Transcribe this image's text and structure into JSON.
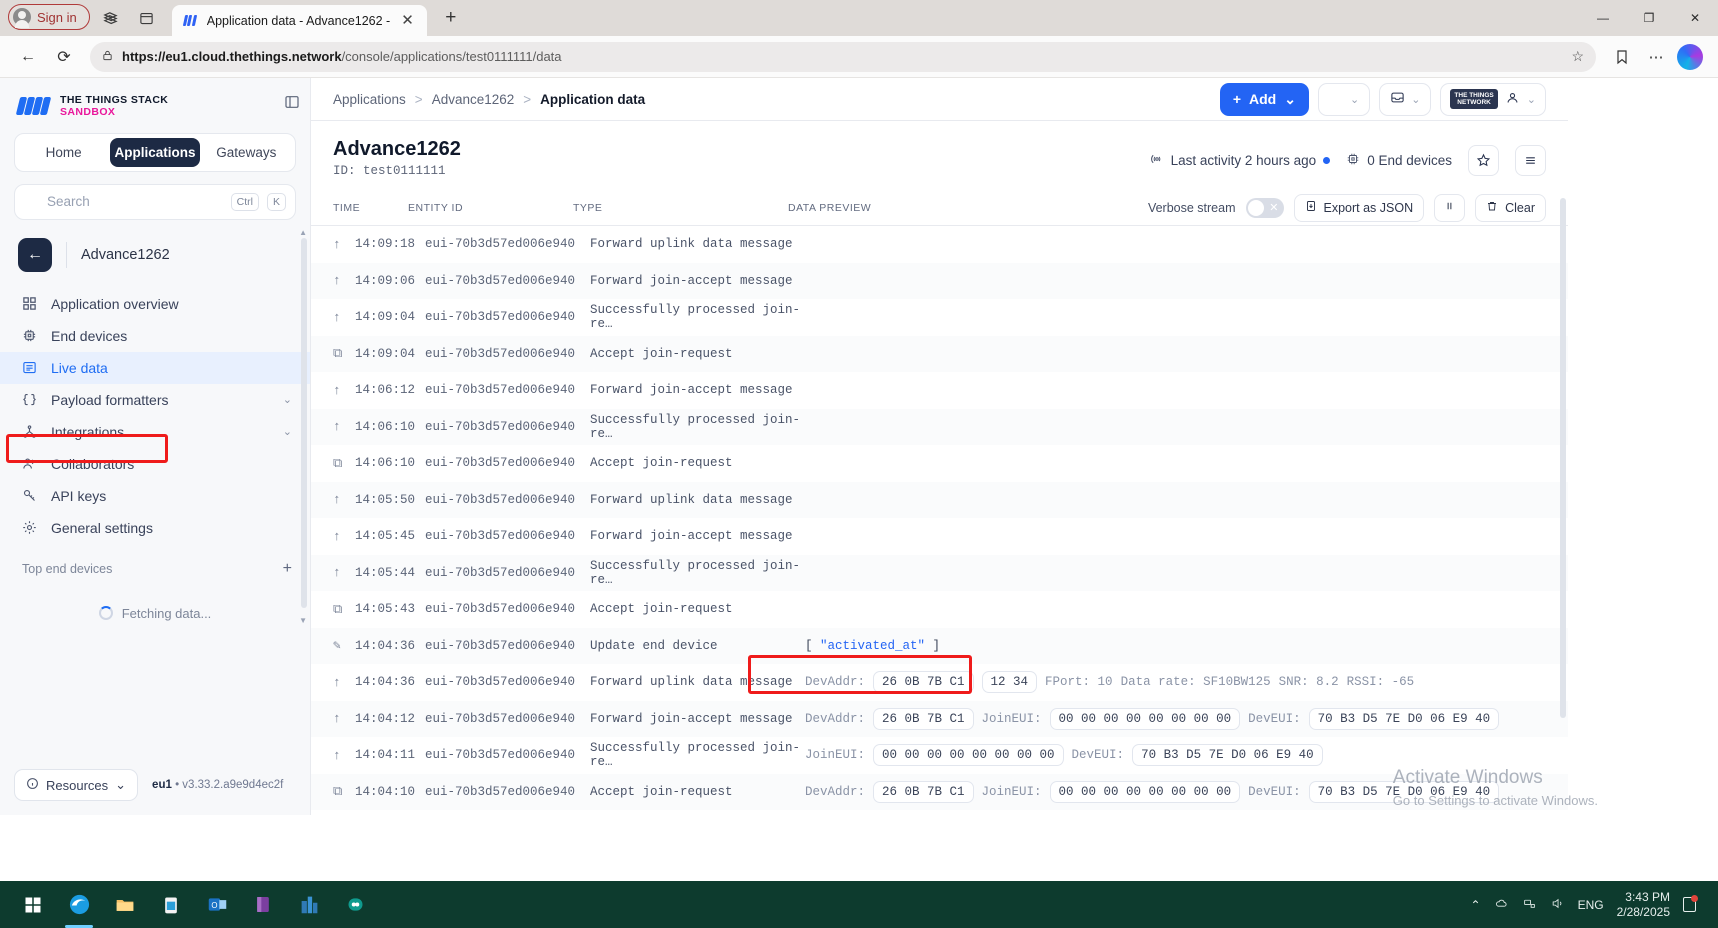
{
  "browser": {
    "signin_label": "Sign in",
    "tab_title": "Application data - Advance1262 -",
    "url_host": "https://eu1.cloud.thethings.network",
    "url_path": "/console/applications/test0111111/data",
    "new_tab_glyph": "+",
    "close_glyph": "✕",
    "minimize_glyph": "—",
    "maximize_glyph": "❐",
    "back_glyph": "←",
    "reload_glyph": "⟳",
    "lock_glyph": "🔒",
    "star_glyph": "☆",
    "collections_glyph": "▣",
    "split_glyph": "▥",
    "favorites_glyph": "☆",
    "more_glyph": "⋯"
  },
  "sidebar": {
    "brand_line1": "THE THINGS STACK",
    "brand_line2": "SANDBOX",
    "collapse_glyph": "◧",
    "tabs": [
      {
        "label": "Home",
        "active": false
      },
      {
        "label": "Applications",
        "active": true
      },
      {
        "label": "Gateways",
        "active": false
      }
    ],
    "search": {
      "placeholder": "Search",
      "kbd1": "Ctrl",
      "kbd2": "K",
      "icon": "search-icon"
    },
    "app_back_glyph": "←",
    "app_name": "Advance1262",
    "items": [
      {
        "label": "Application overview",
        "icon": "grid-icon",
        "active": false,
        "chevron": ""
      },
      {
        "label": "End devices",
        "icon": "chip-icon",
        "active": false,
        "chevron": ""
      },
      {
        "label": "Live data",
        "icon": "list-icon",
        "active": true,
        "chevron": ""
      },
      {
        "label": "Payload formatters",
        "icon": "braces-icon",
        "active": false,
        "chevron": "⌄"
      },
      {
        "label": "Integrations",
        "icon": "network-icon",
        "active": false,
        "chevron": "⌄"
      },
      {
        "label": "Collaborators",
        "icon": "users-icon",
        "active": false,
        "chevron": ""
      },
      {
        "label": "API keys",
        "icon": "key-icon",
        "active": false,
        "chevron": ""
      },
      {
        "label": "General settings",
        "icon": "gear-icon",
        "active": false,
        "chevron": ""
      }
    ],
    "top_end_devices_label": "Top end devices",
    "add_glyph": "+",
    "fetching_label": "Fetching data...",
    "resources_label": "Resources",
    "resources_chevron": "⌄",
    "cluster": "eu1",
    "version": "• v3.33.2.a9e9d4ec2f"
  },
  "breadcrumb": {
    "items": [
      "Applications",
      "Advance1262",
      "Application data"
    ],
    "separator": ">",
    "add_label": "Add",
    "add_plus": "+",
    "chevron": "⌄",
    "star_glyph": "☆",
    "inbox_glyph": "⌷",
    "ttn_chip_l1": "THE THINGS",
    "ttn_chip_l2": "NETWORK",
    "user_glyph": "◉"
  },
  "header": {
    "title": "Advance1262",
    "id_label": "ID: test0111111",
    "last_activity": "Last activity 2 hours ago",
    "last_activity_icon": "signal-icon",
    "end_devices": "0 End devices",
    "end_devices_icon": "chip-icon",
    "star_glyph": "☆",
    "menu_glyph": "☰"
  },
  "table": {
    "columns": [
      "TIME",
      "ENTITY ID",
      "TYPE",
      "DATA PREVIEW"
    ],
    "verbose_label": "Verbose stream",
    "verbose_on": false,
    "verbose_off_glyph": "✕",
    "export_label": "Export as JSON",
    "export_icon": "download-icon",
    "pause_icon": "pause-icon",
    "clear_label": "Clear",
    "clear_icon": "trash-icon",
    "rows": [
      {
        "icon": "uplink-arrow-icon",
        "glyph": "↑",
        "time": "14:09:18",
        "entity": "eui-70b3d57ed006e940",
        "type": "Forward uplink data message",
        "preview": []
      },
      {
        "icon": "uplink-arrow-icon",
        "glyph": "↑",
        "time": "14:09:06",
        "entity": "eui-70b3d57ed006e940",
        "type": "Forward join-accept message",
        "preview": []
      },
      {
        "icon": "uplink-arrow-icon",
        "glyph": "↑",
        "time": "14:09:04",
        "entity": "eui-70b3d57ed006e940",
        "type": "Successfully processed join-re…",
        "preview": []
      },
      {
        "icon": "join-link-icon",
        "glyph": "⧉",
        "time": "14:09:04",
        "entity": "eui-70b3d57ed006e940",
        "type": "Accept join-request",
        "preview": []
      },
      {
        "icon": "uplink-arrow-icon",
        "glyph": "↑",
        "time": "14:06:12",
        "entity": "eui-70b3d57ed006e940",
        "type": "Forward join-accept message",
        "preview": []
      },
      {
        "icon": "uplink-arrow-icon",
        "glyph": "↑",
        "time": "14:06:10",
        "entity": "eui-70b3d57ed006e940",
        "type": "Successfully processed join-re…",
        "preview": []
      },
      {
        "icon": "join-link-icon",
        "glyph": "⧉",
        "time": "14:06:10",
        "entity": "eui-70b3d57ed006e940",
        "type": "Accept join-request",
        "preview": []
      },
      {
        "icon": "uplink-arrow-icon",
        "glyph": "↑",
        "time": "14:05:50",
        "entity": "eui-70b3d57ed006e940",
        "type": "Forward uplink data message",
        "preview": []
      },
      {
        "icon": "uplink-arrow-icon",
        "glyph": "↑",
        "time": "14:05:45",
        "entity": "eui-70b3d57ed006e940",
        "type": "Forward join-accept message",
        "preview": []
      },
      {
        "icon": "uplink-arrow-icon",
        "glyph": "↑",
        "time": "14:05:44",
        "entity": "eui-70b3d57ed006e940",
        "type": "Successfully processed join-re…",
        "preview": []
      },
      {
        "icon": "join-link-icon",
        "glyph": "⧉",
        "time": "14:05:43",
        "entity": "eui-70b3d57ed006e940",
        "type": "Accept join-request",
        "preview": []
      },
      {
        "icon": "edit-pencil-icon",
        "glyph": "✎",
        "time": "14:04:36",
        "entity": "eui-70b3d57ed006e940",
        "type": "Update end device",
        "preview": [
          {
            "kind": "json",
            "text": "[ ",
            "quoted": "\"activated_at\"",
            "tail": " ]"
          }
        ]
      },
      {
        "icon": "uplink-arrow-icon",
        "glyph": "↑",
        "time": "14:04:36",
        "entity": "eui-70b3d57ed006e940",
        "type": "Forward uplink data message",
        "preview": [
          {
            "kind": "kv",
            "text": "DevAddr:"
          },
          {
            "kind": "chip",
            "text": "26 0B 7B C1"
          },
          {
            "kind": "chip",
            "text": "12 34"
          },
          {
            "kind": "kv",
            "text": "FPort: 10"
          },
          {
            "kind": "kv",
            "text": "Data rate: SF10BW125"
          },
          {
            "kind": "kv",
            "text": "SNR: 8.2"
          },
          {
            "kind": "kv",
            "text": "RSSI: -65"
          }
        ]
      },
      {
        "icon": "uplink-arrow-icon",
        "glyph": "↑",
        "time": "14:04:12",
        "entity": "eui-70b3d57ed006e940",
        "type": "Forward join-accept message",
        "preview": [
          {
            "kind": "kv",
            "text": "DevAddr:"
          },
          {
            "kind": "chip",
            "text": "26 0B 7B C1"
          },
          {
            "kind": "kv",
            "text": "JoinEUI:"
          },
          {
            "kind": "chip",
            "text": "00 00 00 00 00 00 00 00"
          },
          {
            "kind": "kv",
            "text": "DevEUI:"
          },
          {
            "kind": "chip",
            "text": "70 B3 D5 7E D0 06 E9 40"
          }
        ]
      },
      {
        "icon": "uplink-arrow-icon",
        "glyph": "↑",
        "time": "14:04:11",
        "entity": "eui-70b3d57ed006e940",
        "type": "Successfully processed join-re…",
        "preview": [
          {
            "kind": "kv",
            "text": "JoinEUI:"
          },
          {
            "kind": "chip",
            "text": "00 00 00 00 00 00 00 00"
          },
          {
            "kind": "kv",
            "text": "DevEUI:"
          },
          {
            "kind": "chip",
            "text": "70 B3 D5 7E D0 06 E9 40"
          }
        ]
      },
      {
        "icon": "join-link-icon",
        "glyph": "⧉",
        "time": "14:04:10",
        "entity": "eui-70b3d57ed006e940",
        "type": "Accept join-request",
        "preview": [
          {
            "kind": "kv",
            "text": "DevAddr:"
          },
          {
            "kind": "chip",
            "text": "26 0B 7B C1"
          },
          {
            "kind": "kv",
            "text": "JoinEUI:"
          },
          {
            "kind": "chip",
            "text": "00 00 00 00 00 00 00 00"
          },
          {
            "kind": "kv",
            "text": "DevEUI:"
          },
          {
            "kind": "chip",
            "text": "70 B3 D5 7E D0 06 E9 40"
          }
        ]
      }
    ]
  },
  "annotations": {
    "highlight_color": "#ef1b1b",
    "boxes": [
      "live-data-nav-item",
      "devaddr-payload-chips"
    ]
  },
  "watermark": {
    "line1": "Activate Windows",
    "line2": "Go to Settings to activate Windows."
  },
  "taskbar": {
    "start_glyph": "⊞",
    "items": [
      "start-icon",
      "edge-icon",
      "file-explorer-icon",
      "store-icon",
      "outlook-icon",
      "onenote-icon",
      "city-app-icon",
      "teal-link-icon"
    ],
    "tray_chevron": "⌃",
    "tray_items": [
      "chevron-up-icon",
      "onedrive-icon",
      "network-icon",
      "volume-icon"
    ],
    "lang": "ENG",
    "time": "3:43 PM",
    "date": "2/28/2025"
  },
  "colors": {
    "accent": "#2364f4",
    "sidebar_bg": "#f7f8fa",
    "active_nav_bg": "#e8f0fe",
    "dark": "#1d2a44",
    "highlight": "#ef1b1b",
    "taskbar": "#0d3b2e"
  }
}
